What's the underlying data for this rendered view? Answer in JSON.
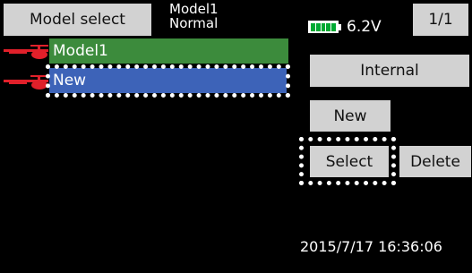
{
  "header": {
    "title": "Model select",
    "model_name": "Model1",
    "condition": "Normal",
    "battery_voltage": "6.2V",
    "page": "1/1"
  },
  "model_list": {
    "items": [
      {
        "label": "Model1",
        "icon": "helicopter-icon",
        "color": "#3c8b3c"
      },
      {
        "label": "New",
        "icon": "helicopter-icon",
        "color": "#3d63b8",
        "selected": true
      }
    ]
  },
  "buttons": {
    "internal": "Internal",
    "new": "New",
    "select": "Select",
    "delete": "Delete"
  },
  "status": {
    "datetime": "2015/7/17 16:36:06"
  },
  "colors": {
    "background": "#000000",
    "button": "#d2d2d2",
    "highlight_green": "#3c8b3c",
    "highlight_blue": "#3d63b8",
    "icon_red": "#e0202a"
  }
}
